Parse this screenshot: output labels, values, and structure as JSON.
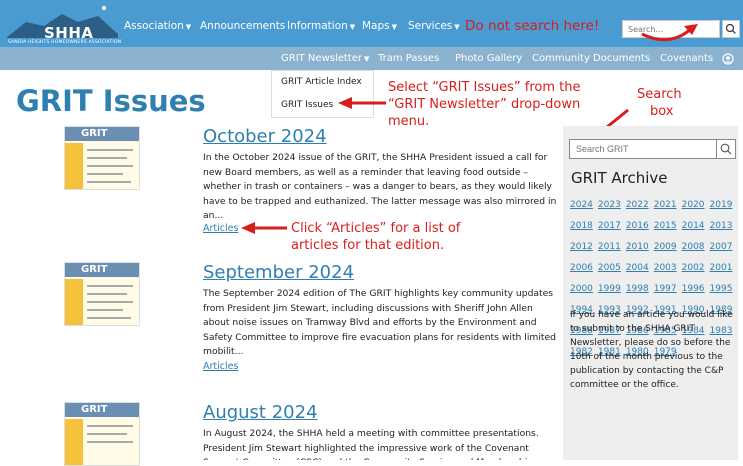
{
  "header": {
    "logo_name": "SHHA",
    "logo_sub": "SANDIA HEIGHTS HOMEOWNERS ASSOCIATION",
    "nav": [
      {
        "label": "Association",
        "caret": true
      },
      {
        "label": "Announcements",
        "caret": false
      },
      {
        "label": "Information",
        "caret": true
      },
      {
        "label": "Maps",
        "caret": true
      },
      {
        "label": "Services",
        "caret": true
      }
    ],
    "search_placeholder": "Search...",
    "subnav": [
      {
        "label": "GRIT Newsletter",
        "caret": true
      },
      {
        "label": "Tram Passes"
      },
      {
        "label": "Photo Gallery"
      },
      {
        "label": "Community Documents"
      },
      {
        "label": "Covenants"
      }
    ],
    "dropdown": [
      "GRIT Article Index",
      "GRIT Issues"
    ]
  },
  "annotations": {
    "do_not_search": "Do not search here!",
    "select_issues_1": "Select “GRIT Issues” from the",
    "select_issues_2": "“GRIT Newsletter” drop-down",
    "select_issues_3": "menu.",
    "search_box_1": "Search",
    "search_box_2": "box",
    "click_articles_1": "Click “Articles” for a list of",
    "click_articles_2": "articles for that edition."
  },
  "page_title": "GRIT Issues",
  "articles": [
    {
      "title": "October 2024",
      "body": "In the October 2024 issue of the GRIT, the SHHA President issued a call for new Board members, as well as a reminder that leaving food outside – whether in trash or containers – was a danger to bears, as they would likely have to be trapped and euthanized. The latter message was also mirrored in an...",
      "link": "Articles"
    },
    {
      "title": "September 2024",
      "body": "The September 2024 edition of The GRIT highlights key community updates from President Jim Stewart, including discussions with Sheriff John Allen about noise issues on Tramway Blvd and efforts by the Environment and Safety Committee to improve fire evacuation plans for residents with limited mobilit...",
      "link": "Articles"
    },
    {
      "title": "August 2024",
      "body": "In August 2024, the SHHA held a meeting with committee presentations. President Jim Stewart highlighted the impressive work of the Covenant Support Committee (CSC) and the Community Service and Membership",
      "link": ""
    }
  ],
  "thumb_label": "GRIT",
  "sidebar": {
    "search_placeholder": "Search GRIT",
    "archive_title": "GRIT Archive",
    "years": [
      "2024",
      "2023",
      "2022",
      "2021",
      "2020",
      "2019",
      "2018",
      "2017",
      "2016",
      "2015",
      "2014",
      "2013",
      "2012",
      "2011",
      "2010",
      "2009",
      "2008",
      "2007",
      "2006",
      "2005",
      "2004",
      "2003",
      "2002",
      "2001",
      "2000",
      "1999",
      "1998",
      "1997",
      "1996",
      "1995",
      "1994",
      "1993",
      "1992",
      "1991",
      "1990",
      "1989",
      "1988",
      "1987",
      "1986",
      "1985",
      "1984",
      "1983",
      "1982",
      "1981",
      "1980",
      "1979"
    ],
    "info_text": "If you have an article you would like to submit to the SHHA GRIT Newsletter, please do so before the 10th of the month previous to the publication by contacting the C&P committee or the office."
  },
  "colors": {
    "nav_blue": "#4a9bd2",
    "title_blue": "#2f7fb0",
    "annotation_red": "#d81d1d"
  }
}
